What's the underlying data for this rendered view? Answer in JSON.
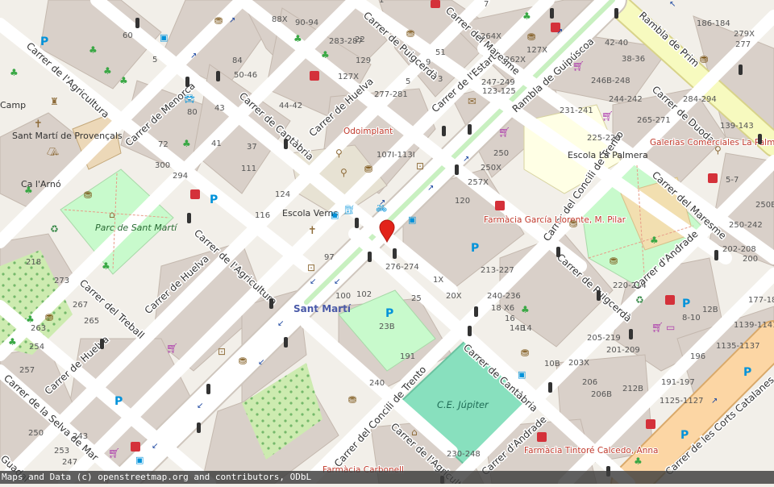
{
  "streets": [
    "Carrer de l'Agricultura",
    "Carrer de Menorca",
    "Carrer de Cantàbria",
    "Carrer de Huelva",
    "Carrer de Puigcerdà",
    "Carrer de l'Estartit",
    "Rambla de Guipúscoa",
    "Rambla de Prim",
    "Carrer del Maresme",
    "Carrer de Duoda",
    "Carrer del Concili de Trento",
    "Carrer de Puigcerdà",
    "Carrer d'Andrade",
    "Carrer del Maresme",
    "Carrer de l'Agricultura",
    "Carrer de Huelva",
    "Carrer del Treball",
    "Carrer de Huelva",
    "Carrer de la Selva de Mar",
    "Carrer de Cantàbria",
    "Carrer del Concili de Trento",
    "Carrer d'Andrade",
    "Carrer de l'Agricult",
    "Carrer d'Andrade",
    "Rambla de",
    "Carrer de les Corts Catalanes",
    "Carrer de Cantàbria",
    "Guadal",
    "Carrer del Maresme"
  ],
  "places": {
    "odoimplant": "Odoimplant",
    "escola_verns": "Escola Verns",
    "escola_palmera": "Escola La Palmera",
    "galerias": "Galerias Comerciales La Palmera",
    "sant_marti_provencals": "Sant Martí de Provençals",
    "ca_arno": "Ca l'Arnó",
    "parc_sant_marti": "Parc de Sant Martí",
    "sant_marti_station": "Sant Martí",
    "ce_jupiter": "C.E. Júpiter",
    "farmacia_garcia": "Farmàcia García Llorente, M. Pilar",
    "farmacia_tintore": "Farmàcia Tintoré Calcedo, Anna",
    "farmacia_carbonell": "Farmàcia Carbonell",
    "camp": "Camp"
  },
  "house_numbers": [
    "88X",
    "90-94",
    "283-287",
    "129",
    "84",
    "50-46",
    "127X",
    "80",
    "43",
    "44-42",
    "72",
    "41",
    "37",
    "300",
    "294",
    "111",
    "124",
    "116",
    "97",
    "100",
    "102",
    "25",
    "23B",
    "191",
    "240",
    "120",
    "257X",
    "250X",
    "250",
    "213-227",
    "240-236",
    "18 X6",
    "16",
    "14B",
    "14",
    "20X",
    "10B",
    "203X",
    "205-219",
    "201-209",
    "206",
    "206B",
    "212B",
    "191-197",
    "1125-1127",
    "196",
    "1135-1137",
    "8-10",
    "12B",
    "177-18",
    "1139-1141",
    "220-214",
    "250-242",
    "202-208",
    "200",
    "250B",
    "5-7",
    "225-229",
    "231-241",
    "265-271",
    "244-242",
    "246B-248",
    "38-36",
    "42-40",
    "264X",
    "262X",
    "127X",
    "247-249",
    "123-125",
    "277-281",
    "107I-113I",
    "284-294",
    "139-143",
    "186-184",
    "279X",
    "277",
    "273",
    "267",
    "265",
    "263",
    "254",
    "257",
    "250",
    "253",
    "247",
    "243",
    "230-248",
    "218",
    "60",
    "5",
    "51",
    "9",
    "3",
    "5",
    "7",
    "1",
    "1X",
    "276-274",
    "22",
    "21",
    "188"
  ],
  "attribution": "Maps and Data (c) openstreetmap.org and contributors, ODbL",
  "colors": {
    "background": "#f2efe9",
    "building": "#d9d0c9",
    "park": "#c8facc",
    "pitch": "#88e0be",
    "school": "#ffffe5",
    "road_major": "#ffffff",
    "road_trunk": "#fcd6a4",
    "marker": "#e2231a"
  }
}
